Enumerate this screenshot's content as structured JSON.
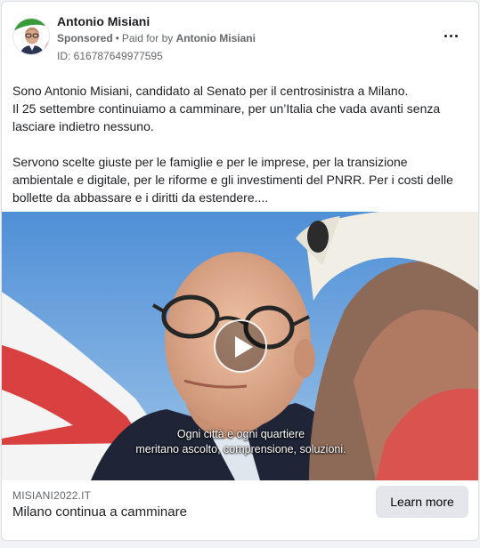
{
  "post": {
    "author": "Antonio Misiani",
    "sponsored_label": "Sponsored",
    "paid_for_prefix": "Paid for by",
    "paid_for_by": "Antonio Misiani",
    "ad_id": "ID: 616787649977595",
    "body_lines_1": [
      "Sono Antonio Misiani, candidato al Senato per il centrosinistra a Milano.",
      "Il 25 settembre continuiamo a camminare, per un’Italia che vada avanti senza lasciare indietro nessuno."
    ],
    "body_line_2": "Servono scelte giuste per le famiglie e per le imprese, per la transizione ambientale e digitale, per le riforme e gli investimenti del PNRR. Per i costi delle bollette da abbassare e i diritti da estendere...."
  },
  "video": {
    "subtitle_line_1": "Ogni città e ogni quartiere",
    "subtitle_line_2": "meritano ascolto, comprensione, soluzioni.",
    "play_icon": "play-icon"
  },
  "link": {
    "domain": "MISIANI2022.IT",
    "headline": "Milano continua a camminare",
    "cta_label": "Learn more"
  },
  "colors": {
    "text_primary": "#1c1e21",
    "text_secondary": "#65676b",
    "button_bg": "#e4e6eb",
    "sky": "#6fa3d6",
    "flag_red": "#d94040"
  }
}
